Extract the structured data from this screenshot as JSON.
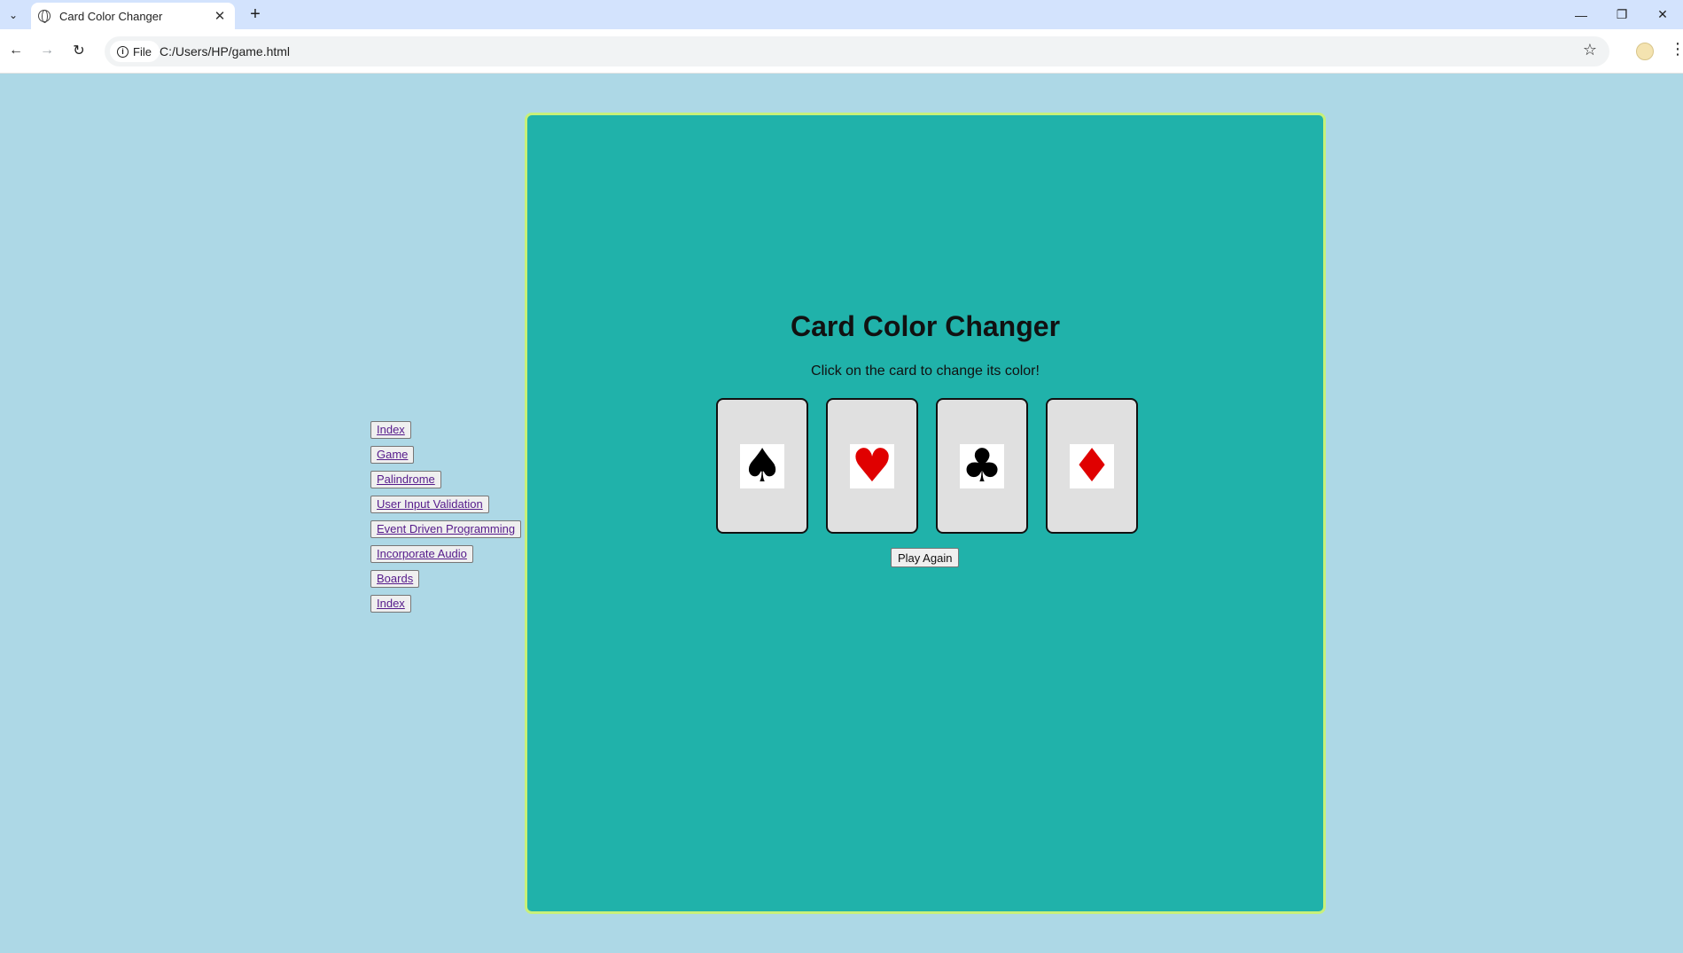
{
  "browser": {
    "tab_title": "Card Color Changer",
    "new_tab": "+",
    "address_chip": "File",
    "url": "C:/Users/HP/game.html"
  },
  "sidebar": {
    "links": [
      "Index",
      "Game",
      "Palindrome",
      "User Input Validation",
      "Event Driven Programming",
      "Incorporate Audio",
      "Boards",
      "Index"
    ]
  },
  "game": {
    "title": "Card Color Changer",
    "instructions": "Click on the card to change its color!",
    "cards": [
      {
        "suit": "spade-icon",
        "glyph": "♠",
        "color": "#000000"
      },
      {
        "suit": "heart-icon",
        "glyph": "♥",
        "color": "#e00000"
      },
      {
        "suit": "club-icon",
        "glyph": "♣",
        "color": "#000000"
      },
      {
        "suit": "diamond-icon",
        "glyph": "♦",
        "color": "#e00000"
      }
    ],
    "play_again_label": "Play Again"
  },
  "colors": {
    "page_bg": "#add8e6",
    "panel_bg": "#20b2aa",
    "panel_border": "#c8f07a",
    "card_bg": "#e0e0e0"
  }
}
